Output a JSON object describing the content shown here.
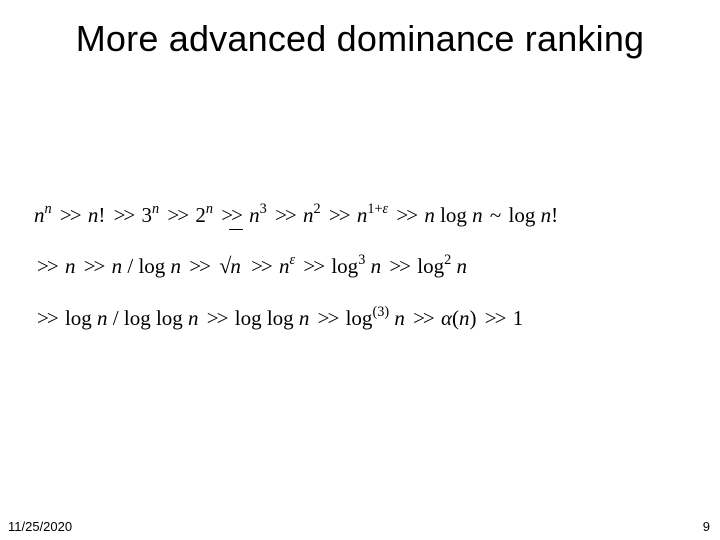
{
  "slide": {
    "title": "More advanced dominance ranking",
    "footer": {
      "date": "11/25/2020",
      "page": "9"
    }
  },
  "math": {
    "gg": ">>",
    "tilde": "~",
    "l1": {
      "t1a": "n",
      "t1b": "n",
      "t2a": "n",
      "t2b": "!",
      "t3a": "3",
      "t3b": "n",
      "t4a": "2",
      "t4b": "n",
      "t5a": "n",
      "t5b": "3",
      "t6a": "n",
      "t6b": "2",
      "t7a": "n",
      "t7b": "1+",
      "t7c": "ε",
      "t8a": "n",
      "t8b": " log ",
      "t8c": "n",
      "t9a": "log ",
      "t9b": "n",
      "t9c": "!"
    },
    "l2": {
      "t1": "n",
      "t2a": "n",
      "t2b": " / log ",
      "t2c": "n",
      "t3": "n",
      "t4a": "n",
      "t4b": "ε",
      "t5a": "log",
      "t5b": "3",
      "t5c": " n",
      "t6a": "log",
      "t6b": "2",
      "t6c": " n"
    },
    "l3": {
      "t1a": "log ",
      "t1b": "n",
      "t1c": " / log log ",
      "t1d": "n",
      "t2a": "log log ",
      "t2b": "n",
      "t3a": "log",
      "t3b": "(3)",
      "t3c": " n",
      "t4a": "α",
      "t4b": "(",
      "t4c": "n",
      "t4d": ")",
      "t5": "1"
    }
  }
}
